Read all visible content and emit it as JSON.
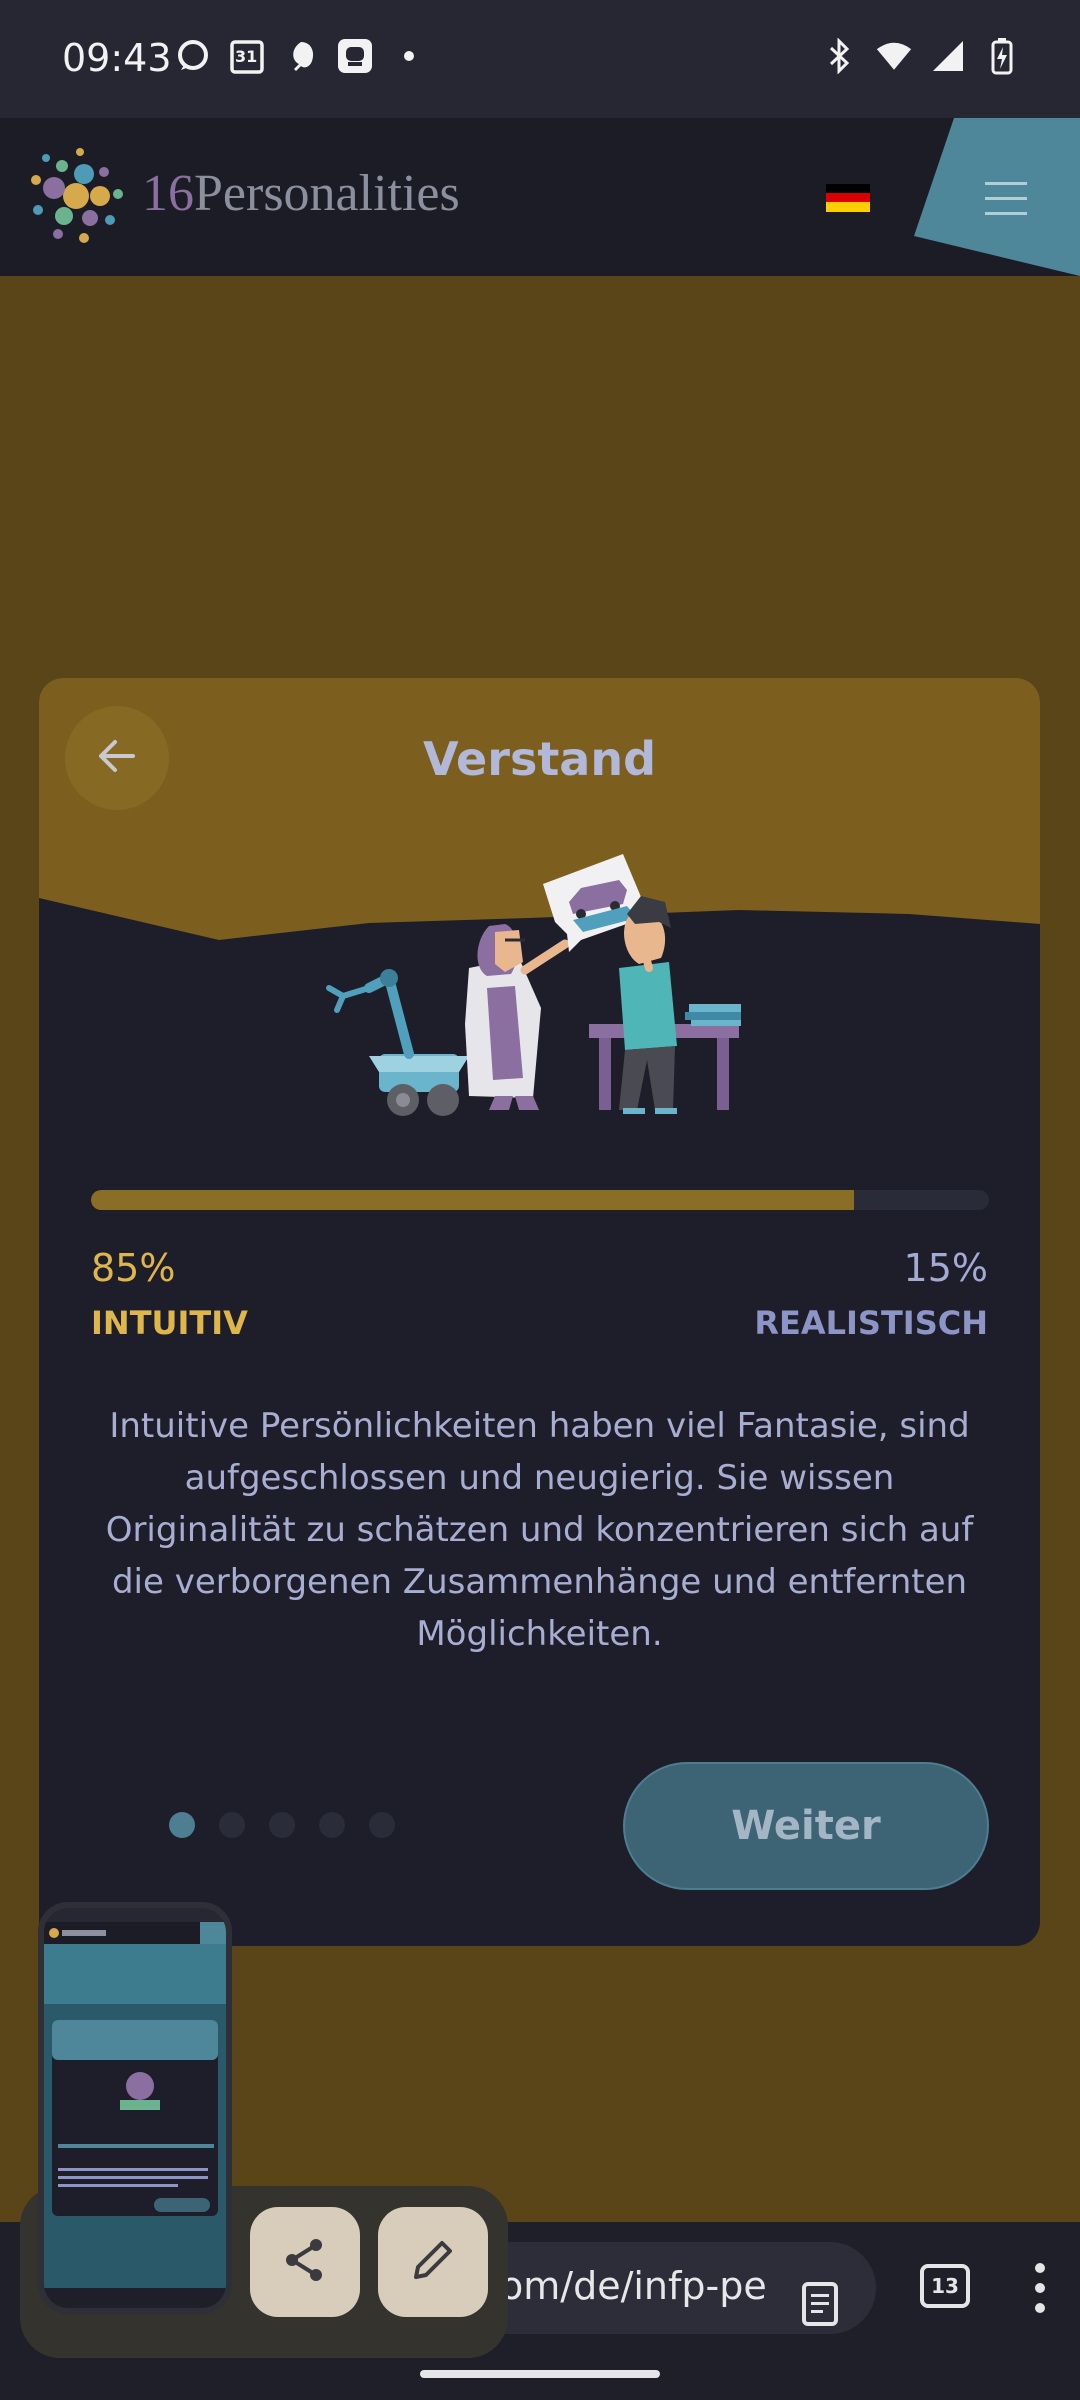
{
  "status_bar": {
    "time": "09:43",
    "calendar_day": "31",
    "left_icons": [
      "chat-bubble-icon",
      "calendar-icon",
      "leaf-icon",
      "face-icon",
      "dot-icon"
    ],
    "right_icons": [
      "bluetooth-icon",
      "wifi-icon",
      "signal-icon",
      "battery-icon"
    ]
  },
  "header": {
    "logo_number": "16",
    "logo_name": "Personalities",
    "language_flag": "german-flag-icon",
    "menu_icon": "hamburger-menu-icon"
  },
  "card": {
    "title": "Verstand",
    "back_icon": "arrow-left-icon",
    "progress": {
      "left_percent": 85,
      "right_percent": 15
    },
    "left_percent_text": "85%",
    "left_label": "INTUITIV",
    "right_percent_text": "15%",
    "right_label": "REALISTISCH",
    "description": "Intuitive Persönlichkeiten haben viel Fantasie, sind aufgeschlossen und neugierig. Sie wissen Originalität zu schätzen und konzentrieren sich auf die verborgenen Zusammenhänge und entfernten Möglichkeiten.",
    "pager": {
      "total": 5,
      "active": 1
    },
    "next_button": "Weiter"
  },
  "browser": {
    "url": "om/de/infp-pers",
    "tab_count": "13"
  },
  "colors": {
    "page_background": "#5a4518",
    "card_background": "#1d1e29",
    "accent_gold": "#dfb64c",
    "accent_blue": "#8c95c5",
    "button_teal": "#3d6474"
  }
}
